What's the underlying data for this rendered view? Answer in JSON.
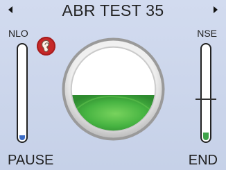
{
  "header": {
    "title": "ABR TEST 35",
    "prev_icon": "chevron-left-icon",
    "next_icon": "chevron-right-icon"
  },
  "left_panel": {
    "label": "NLO",
    "icon": "ear-icon",
    "meter_level": 0.05,
    "meter_color": "#3b6bc4"
  },
  "right_panel": {
    "label": "NSE",
    "meter_level": 0.08,
    "meter_color": "#3fa34a",
    "threshold_level": 0.43
  },
  "gauge": {
    "fill_level": 0.43,
    "fill_color": "#4caf50"
  },
  "footer": {
    "pause_label": "PAUSE",
    "end_label": "END"
  }
}
